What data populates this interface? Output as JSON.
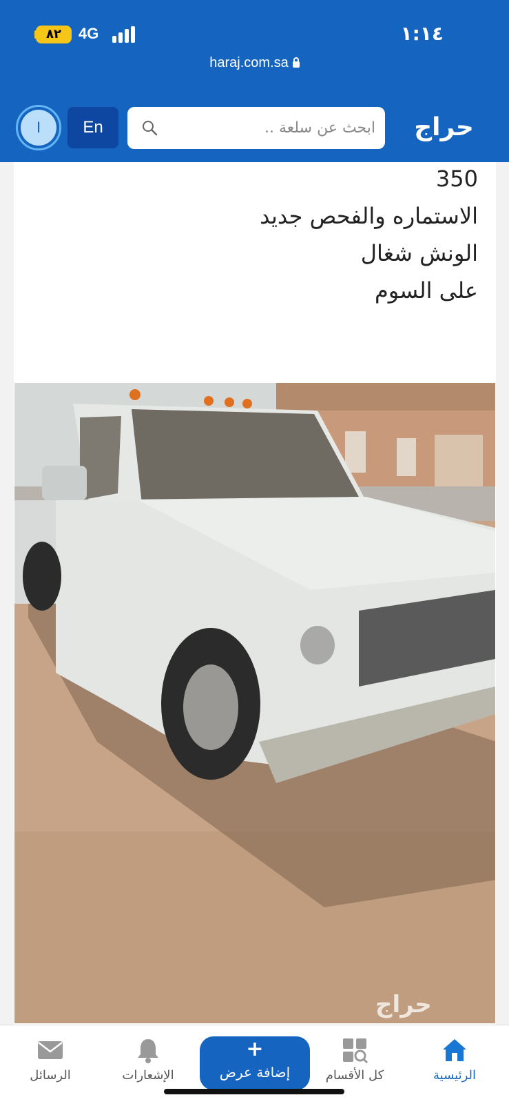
{
  "status_bar": {
    "battery": "٨٢",
    "network": "4G",
    "time": "١:١٤"
  },
  "browser": {
    "url": "haraj.com.sa"
  },
  "header": {
    "logo": "حراج",
    "search_placeholder": "ابحث عن سلعة ..",
    "lang_label": "En",
    "avatar_initial": "I",
    "colors": {
      "brand": "#1565c0",
      "brand_dark": "#0d47a1"
    }
  },
  "post": {
    "description_lines": [
      "350",
      "الاستماره والفحص جديد",
      "الونش شغال",
      "على السوم"
    ],
    "photo_watermark": "حراج"
  },
  "bottom_nav": {
    "items": [
      {
        "id": "home",
        "label": "الرئيسية",
        "icon": "home-icon",
        "active": true
      },
      {
        "id": "categories",
        "label": "كل الأقسام",
        "icon": "categories-icon",
        "active": false
      },
      {
        "id": "add",
        "label": "إضافة عرض",
        "icon": "plus-icon",
        "active": false
      },
      {
        "id": "notifications",
        "label": "الإشعارات",
        "icon": "bell-icon",
        "active": false
      },
      {
        "id": "messages",
        "label": "الرسائل",
        "icon": "mail-icon",
        "active": false
      }
    ]
  }
}
